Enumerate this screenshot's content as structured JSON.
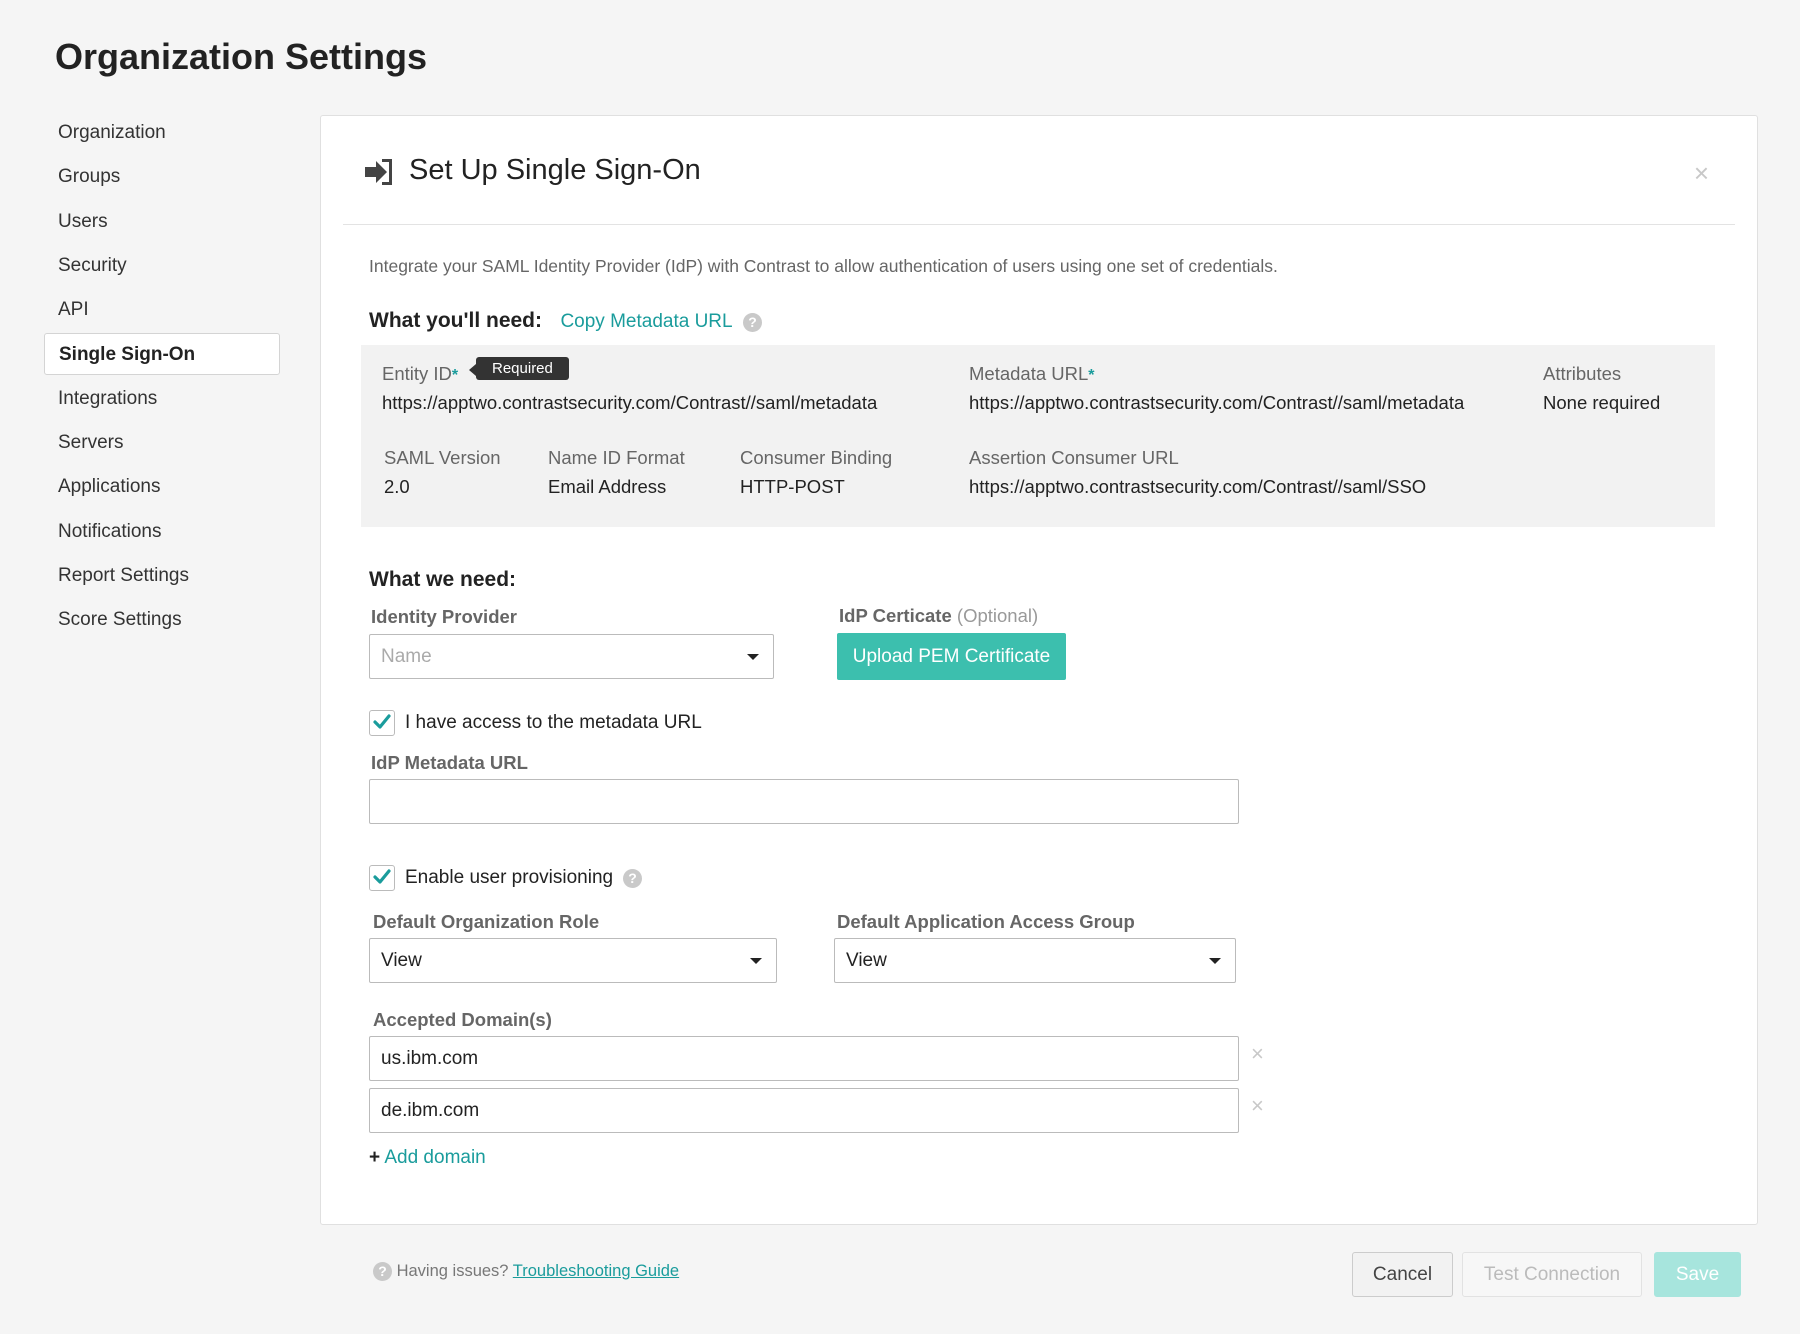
{
  "page": {
    "title": "Organization Settings"
  },
  "sidebar": {
    "items": [
      {
        "label": "Organization"
      },
      {
        "label": "Groups"
      },
      {
        "label": "Users"
      },
      {
        "label": "Security"
      },
      {
        "label": "API"
      },
      {
        "label": "Single Sign-On",
        "active": true
      },
      {
        "label": "Integrations"
      },
      {
        "label": "Servers"
      },
      {
        "label": "Applications"
      },
      {
        "label": "Notifications"
      },
      {
        "label": "Report Settings"
      },
      {
        "label": "Score Settings"
      }
    ]
  },
  "panel": {
    "title": "Set Up Single Sign-On",
    "close_label": "×",
    "intro": "Integrate your SAML Identity Provider (IdP) with Contrast to allow authentication of users using one set of credentials.",
    "need": {
      "heading": "What you'll need:",
      "copy_link": "Copy Metadata URL",
      "help_glyph": "?",
      "tooltip": "Required",
      "asterisk": "*",
      "entity_id": {
        "label": "Entity ID",
        "value": "https://apptwo.contrastsecurity.com/Contrast//saml/metadata"
      },
      "metadata_url": {
        "label": "Metadata URL",
        "value": "https://apptwo.contrastsecurity.com/Contrast//saml/metadata"
      },
      "attributes": {
        "label": "Attributes",
        "value": "None required"
      },
      "saml_version": {
        "label": "SAML Version",
        "value": "2.0"
      },
      "name_id_format": {
        "label": "Name ID Format",
        "value": "Email Address"
      },
      "consumer_binding": {
        "label": "Consumer Binding",
        "value": "HTTP-POST"
      },
      "acs_url": {
        "label": "Assertion Consumer URL",
        "value": "https://apptwo.contrastsecurity.com/Contrast//saml/SSO"
      }
    },
    "we_need": {
      "heading": "What we need:",
      "identity_provider": {
        "label": "Identity Provider",
        "placeholder": "Name"
      },
      "idp_certificate": {
        "label": "IdP Certicate",
        "optional": "(Optional)",
        "button": "Upload PEM Certificate"
      },
      "metadata_access": {
        "label": "I have access to the metadata URL",
        "checked": true
      },
      "idp_metadata_url": {
        "label": "IdP Metadata URL",
        "value": ""
      },
      "provisioning": {
        "label": "Enable user provisioning",
        "checked": true
      },
      "default_org_role": {
        "label": "Default Organization Role",
        "value": "View"
      },
      "default_app_group": {
        "label": "Default Application Access Group",
        "value": "View"
      },
      "accepted_domains": {
        "label": "Accepted Domain(s)",
        "values": [
          "us.ibm.com",
          "de.ibm.com"
        ],
        "remove_glyph": "×"
      },
      "add_domain": {
        "plus": "+",
        "label": "Add domain"
      }
    }
  },
  "footer": {
    "help_glyph": "?",
    "help_text": "Having issues?",
    "help_link": "Troubleshooting Guide",
    "cancel": "Cancel",
    "test": "Test Connection",
    "save": "Save"
  },
  "colors": {
    "accent": "#1a9c9c",
    "primary_button": "#3cbfae",
    "save_disabled": "#a7e5dd"
  }
}
